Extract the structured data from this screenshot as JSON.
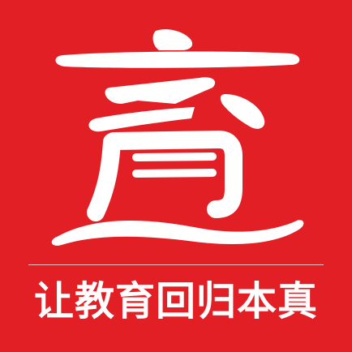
{
  "app": {
    "logo_character": "育",
    "slogan": "让教育回归本真"
  },
  "colors": {
    "background": "#e31f26",
    "foreground": "#ffffff",
    "divider": "#f6c2c3"
  }
}
